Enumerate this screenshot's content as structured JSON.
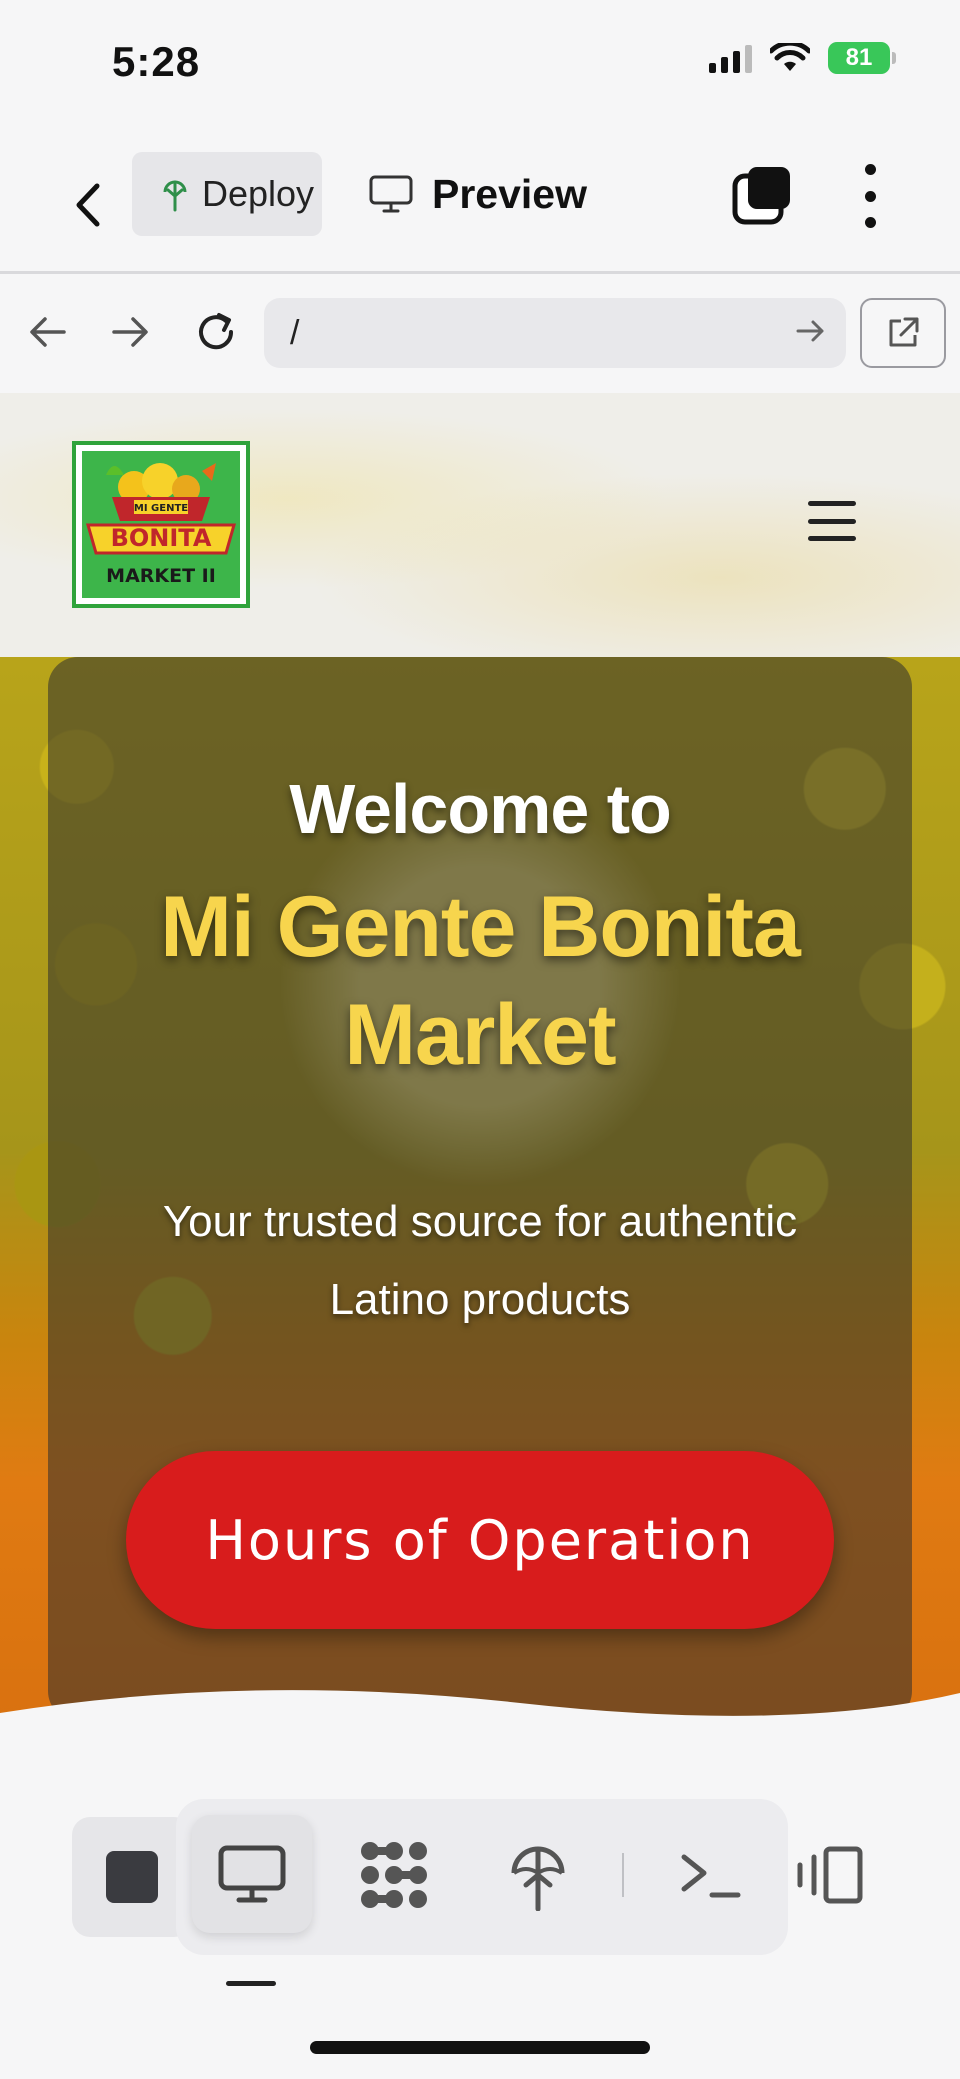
{
  "status_bar": {
    "time": "5:28",
    "battery": "81"
  },
  "toolbar": {
    "deploy_label": "Deploy",
    "preview_label": "Preview"
  },
  "browser": {
    "url": "/"
  },
  "site": {
    "logo_line1": "MI GENTE",
    "logo_line2": "BONITA",
    "logo_line3": "MARKET II",
    "welcome": "Welcome to",
    "market_name": "Mi Gente Bonita Market",
    "tagline": "Your trusted source for authentic Latino products",
    "hours_button": "Hours of Operation"
  },
  "colors": {
    "accent_yellow": "#f7d54d",
    "button_red": "#d81c1c",
    "logo_green": "#2fa33b",
    "battery_green": "#39c759"
  },
  "icons": [
    "back-icon",
    "deploy-icon",
    "monitor-icon",
    "tabs-icon",
    "more-icon",
    "arrow-left-icon",
    "arrow-right-icon",
    "reload-icon",
    "go-arrow-icon",
    "external-link-icon",
    "menu-icon",
    "stop-icon",
    "desktop-icon",
    "dots-grid-icon",
    "deploy-icon",
    "terminal-icon",
    "split-view-icon"
  ]
}
